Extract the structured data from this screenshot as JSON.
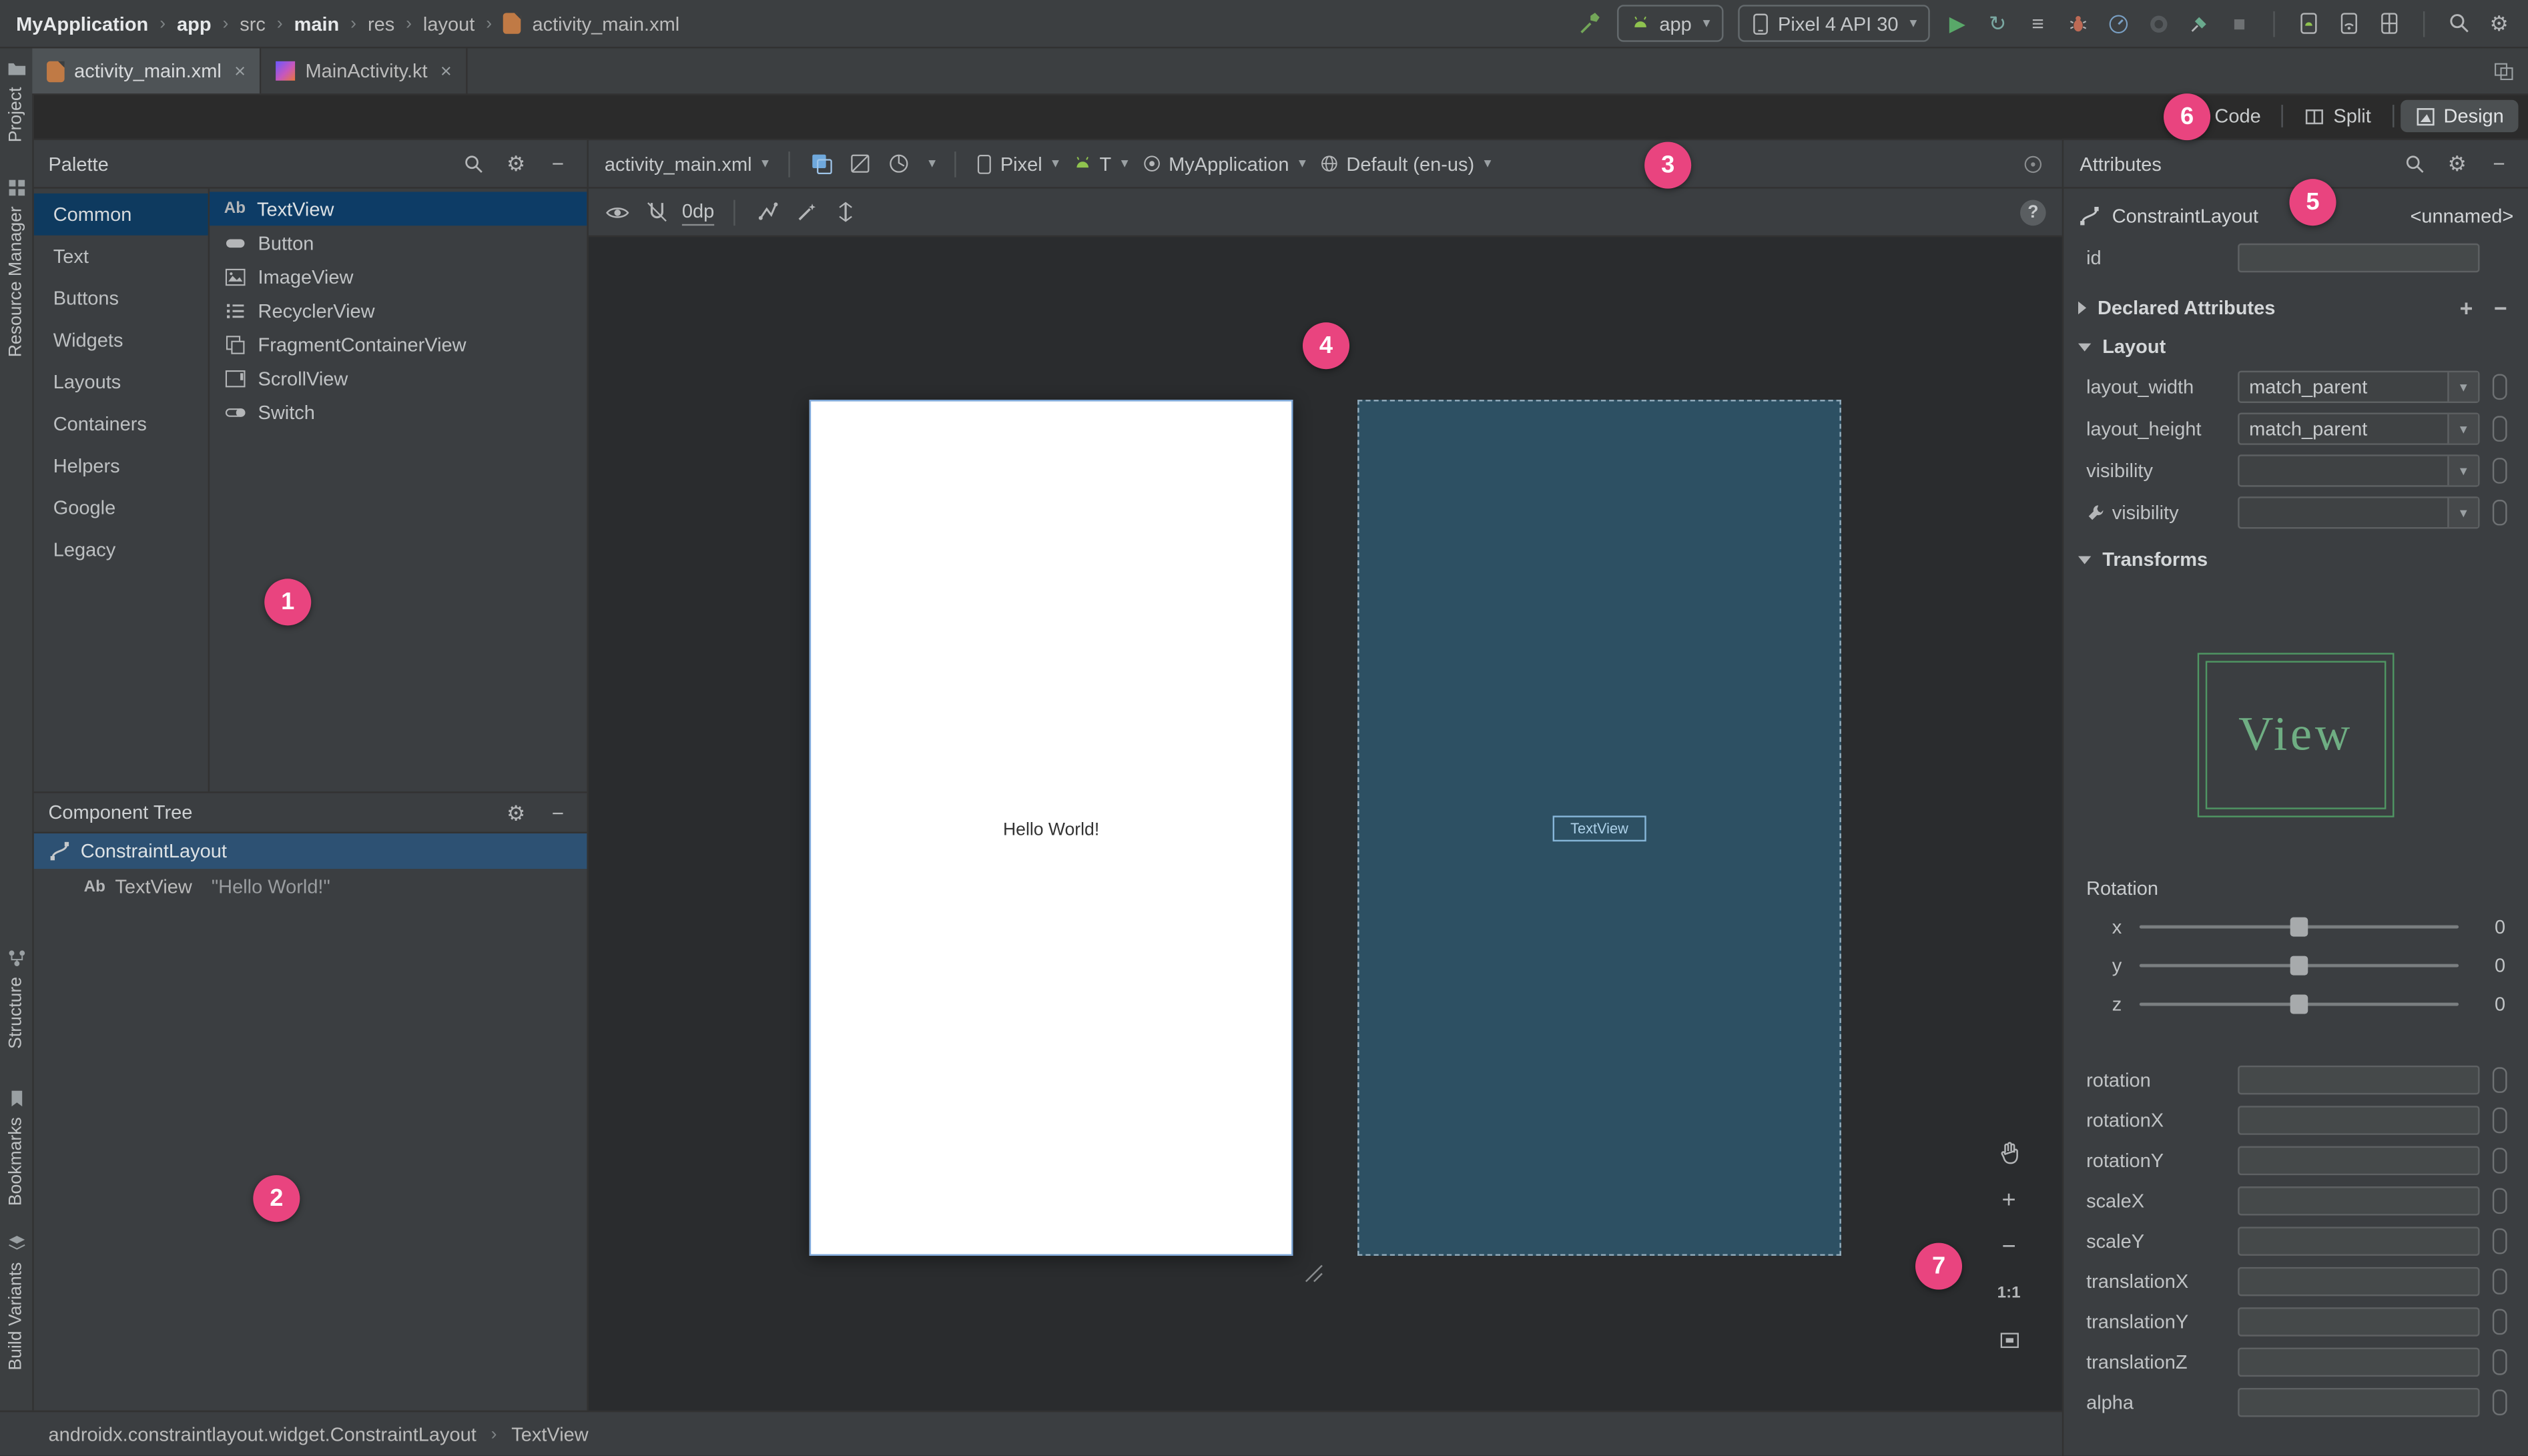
{
  "topbar": {
    "breadcrumbs": [
      "MyApplication",
      "app",
      "src",
      "main",
      "res",
      "layout",
      "activity_main.xml"
    ],
    "run_config_label": "app",
    "device_label": "Pixel 4 API 30"
  },
  "tabs": {
    "tab1": "activity_main.xml",
    "tab2": "MainActivity.kt"
  },
  "mode_toggle": {
    "code": "Code",
    "split": "Split",
    "design": "Design"
  },
  "tool_strips": {
    "project": "Project",
    "resource_manager": "Resource Manager",
    "structure": "Structure",
    "bookmarks": "Bookmarks",
    "build_variants": "Build Variants"
  },
  "palette": {
    "title": "Palette",
    "categories": [
      "Common",
      "Text",
      "Buttons",
      "Widgets",
      "Layouts",
      "Containers",
      "Helpers",
      "Google",
      "Legacy"
    ],
    "components": [
      {
        "label": "TextView"
      },
      {
        "label": "Button"
      },
      {
        "label": "ImageView"
      },
      {
        "label": "RecyclerView"
      },
      {
        "label": "FragmentContainerView"
      },
      {
        "label": "ScrollView"
      },
      {
        "label": "Switch"
      }
    ]
  },
  "component_tree": {
    "title": "Component Tree",
    "root": "ConstraintLayout",
    "child": "TextView",
    "child_detail": "\"Hello World!\""
  },
  "design_toolbar": {
    "file_selector": "activity_main.xml",
    "device_selector": "Pixel",
    "api_selector": "T",
    "theme_selector": "MyApplication",
    "locale_selector": "Default (en-us)",
    "margin": "0dp"
  },
  "canvas": {
    "hello_text": "Hello World!",
    "blueprint_textview": "TextView",
    "zoom_label": "1:1"
  },
  "attributes": {
    "title": "Attributes",
    "component_type": "ConstraintLayout",
    "component_name": "<unnamed>",
    "id_label": "id",
    "id_value": "",
    "declared_section": "Declared Attributes",
    "layout_section": "Layout",
    "layout_rows": [
      {
        "label": "layout_width",
        "value": "match_parent"
      },
      {
        "label": "layout_height",
        "value": "match_parent"
      },
      {
        "label": "visibility",
        "value": ""
      },
      {
        "label": "visibility",
        "value": ""
      }
    ],
    "transforms_section": "Transforms",
    "view_preview_label": "View",
    "rotation_label": "Rotation",
    "sliders": [
      {
        "axis": "x",
        "value": "0"
      },
      {
        "axis": "y",
        "value": "0"
      },
      {
        "axis": "z",
        "value": "0"
      }
    ],
    "transform_fields": [
      "rotation",
      "rotationX",
      "rotationY",
      "scaleX",
      "scaleY",
      "translationX",
      "translationY",
      "translationZ",
      "alpha"
    ]
  },
  "status_bar": {
    "class_path": "androidx.constraintlayout.widget.ConstraintLayout",
    "selected": "TextView"
  },
  "badges": {
    "b1": "1",
    "b2": "2",
    "b3": "3",
    "b4": "4",
    "b5": "5",
    "b6": "6",
    "b7": "7"
  },
  "icons": {
    "chevron": "›",
    "dropdown": "▾",
    "close": "×",
    "minus": "−",
    "plus": "+",
    "gear": "⚙",
    "play": "▶",
    "stop": "■",
    "rerun": "↻",
    "lines": "≡",
    "help": "?"
  }
}
